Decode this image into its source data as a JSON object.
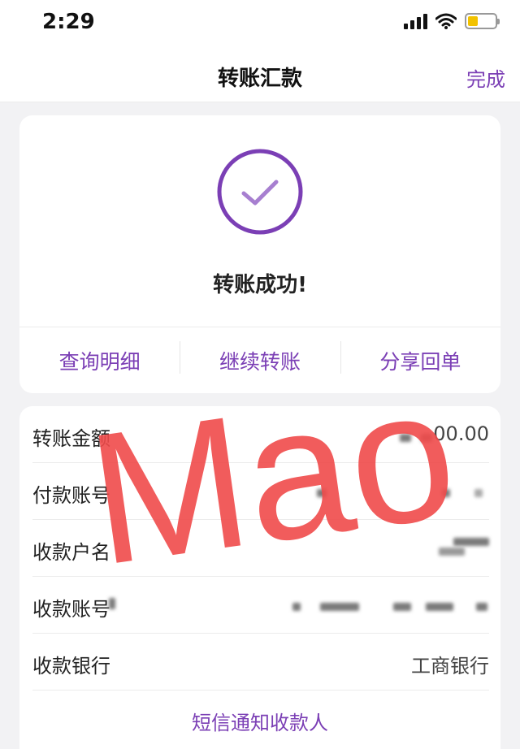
{
  "status_bar": {
    "time": "2:29"
  },
  "nav": {
    "title": "转账汇款",
    "done_label": "完成"
  },
  "success": {
    "message": "转账成功!",
    "actions": [
      {
        "label": "查询明细"
      },
      {
        "label": "继续转账"
      },
      {
        "label": "分享回单"
      }
    ]
  },
  "details": {
    "rows": [
      {
        "label": "转账金额",
        "value": "00.00"
      },
      {
        "label": "付款账号",
        "value": ""
      },
      {
        "label": "收款户名",
        "value": ""
      },
      {
        "label": "收款账号",
        "value": ""
      },
      {
        "label": "收款银行",
        "value": "工商银行"
      }
    ],
    "sms_label": "短信通知收款人"
  },
  "watermark": {
    "text": "Mao"
  },
  "colors": {
    "accent": "#7b3fb5",
    "watermark": "#f04b4b",
    "battery": "#f2c200"
  }
}
